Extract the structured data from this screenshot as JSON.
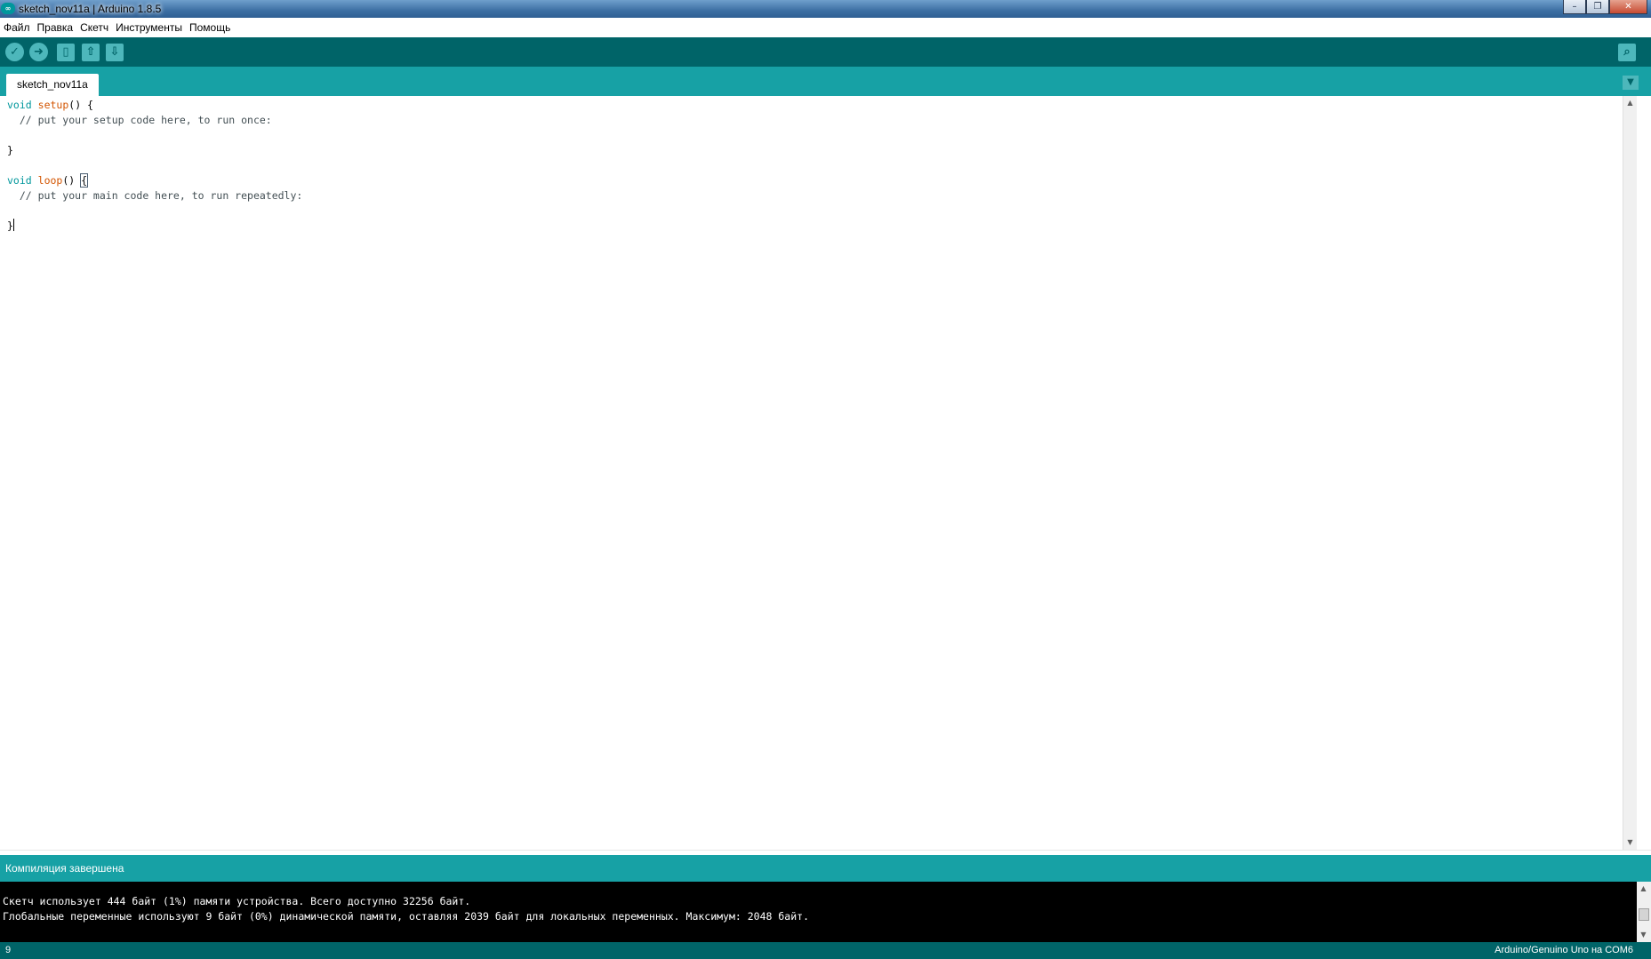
{
  "window": {
    "title": "sketch_nov11a | Arduino 1.8.5",
    "buttons": {
      "minimize": "–",
      "maximize": "❐",
      "close": "✕"
    }
  },
  "menu": [
    "Файл",
    "Правка",
    "Скетч",
    "Инструменты",
    "Помощь"
  ],
  "toolbar": {
    "icons": [
      "verify-icon",
      "upload-icon",
      "new-icon",
      "open-icon",
      "save-icon",
      "serial-monitor-icon"
    ]
  },
  "tabs": {
    "active": "sketch_nov11a",
    "menu_icon": "chevron-down-icon"
  },
  "editor": {
    "lines": [
      "void setup() {",
      "  // put your setup code here, to run once:",
      "",
      "}",
      "",
      "void loop() {",
      "  // put your main code here, to run repeatedly:",
      "",
      "}"
    ]
  },
  "status": {
    "message": "Компиляция завершена"
  },
  "console": {
    "lines": [
      "Скетч использует 444 байт (1%) памяти устройства. Всего доступно 32256 байт.",
      "Глобальные переменные используют 9 байт (0%) динамической памяти, оставляя 2039 байт для локальных переменных. Максимум: 2048 байт."
    ]
  },
  "footer": {
    "line_number": "9",
    "board": "Arduino/Genuino Uno на COM6"
  },
  "colors": {
    "toolbar_bg": "#006468",
    "tab_bar_bg": "#17a1a5",
    "button_bg": "#4db7bb",
    "keyword": "#00979c",
    "function": "#d35400",
    "console_bg": "#000000"
  }
}
